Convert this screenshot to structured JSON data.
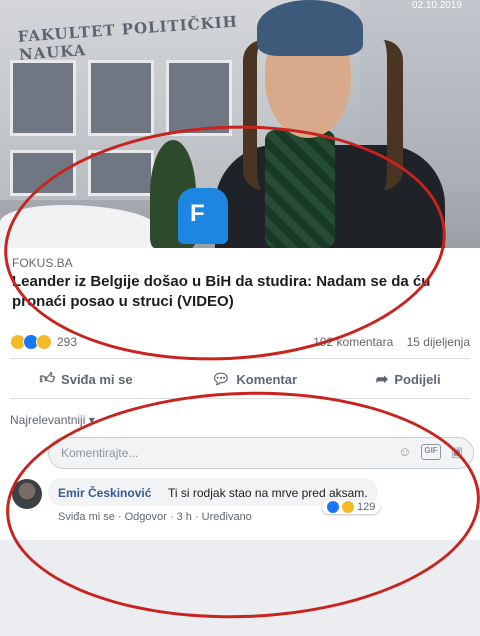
{
  "photo": {
    "timestamp": "02.10.2019",
    "building_sign": "FAKULTET POLITIČKIH NAUKA",
    "mic_logo": "F"
  },
  "post": {
    "source": "FOKUS.BA",
    "headline": "Leander iz Belgije došao u BiH da studira: Nadam se da ću pronaći posao u struci (VIDEO)",
    "reaction_count": "293",
    "comments_count": "192 komentara",
    "shares_count": "15 dijeljenja"
  },
  "actions": {
    "like": "Sviđa mi se",
    "comment": "Komentar",
    "share": "Podijeli"
  },
  "comments": {
    "sort_label": "Najrelevantniji ▾",
    "input_placeholder": "Komentirajte...",
    "gif_label": "GIF",
    "items": [
      {
        "author": "Emir Českinović",
        "text": "Ti si rodjak stao na mrve pred aksam.",
        "meta": "Sviđa mi se · Odgovor · 3 h · Uređivano",
        "reactions": "129"
      }
    ]
  },
  "colors": {
    "annotation_red": "#c8231f",
    "link_blue": "#385898",
    "like_blue": "#1877f2",
    "haha_yellow": "#f7b928"
  }
}
